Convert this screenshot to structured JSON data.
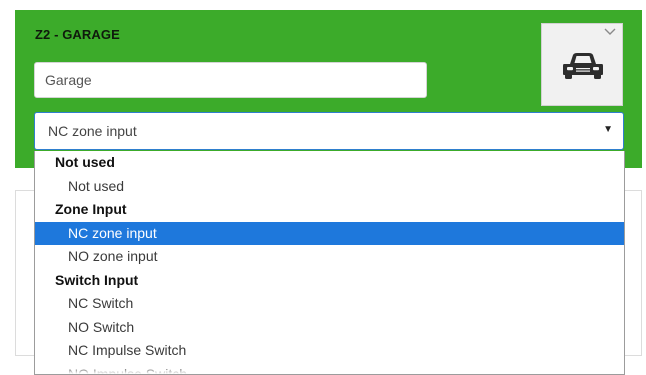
{
  "zone": {
    "title": "Z2 - GARAGE",
    "name_value": "Garage",
    "icon": "car-icon",
    "accent_color": "#3cab2a"
  },
  "type_select": {
    "value": "NC zone input",
    "selected_color": "#1e78dc",
    "groups": [
      {
        "label": "Not used",
        "options": [
          "Not used"
        ]
      },
      {
        "label": "Zone Input",
        "options": [
          "NC zone input",
          "NO zone input"
        ]
      },
      {
        "label": "Switch Input",
        "options": [
          "NC Switch",
          "NO Switch",
          "NC Impulse Switch",
          "NO Impulse Switch"
        ]
      }
    ]
  }
}
